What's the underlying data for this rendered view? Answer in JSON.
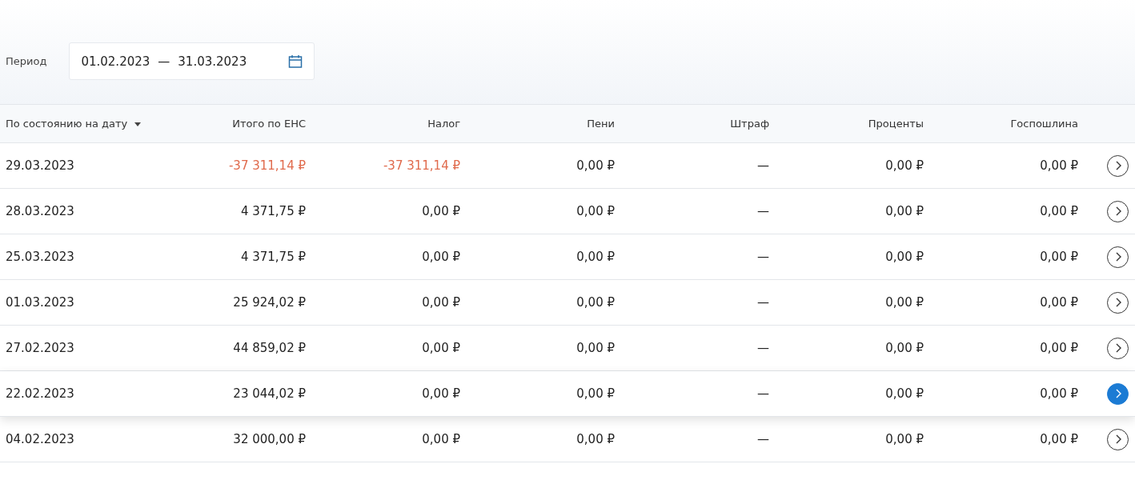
{
  "period": {
    "label": "Период",
    "from": "01.02.2023",
    "separator": "—",
    "to": "31.03.2023"
  },
  "table": {
    "columns": [
      "По состоянию на дату",
      "Итого по ЕНС",
      "Налог",
      "Пени",
      "Штраф",
      "Проценты",
      "Госпошлина"
    ],
    "rows": [
      {
        "selected": false,
        "cells": [
          {
            "text": "29.03.2023",
            "negative": false
          },
          {
            "text": "-37 311,14 ₽",
            "negative": true
          },
          {
            "text": "-37 311,14 ₽",
            "negative": true
          },
          {
            "text": "0,00 ₽",
            "negative": false
          },
          {
            "text": "—",
            "negative": false
          },
          {
            "text": "0,00 ₽",
            "negative": false
          },
          {
            "text": "0,00 ₽",
            "negative": false
          }
        ]
      },
      {
        "selected": false,
        "cells": [
          {
            "text": "28.03.2023",
            "negative": false
          },
          {
            "text": "4 371,75 ₽",
            "negative": false
          },
          {
            "text": "0,00 ₽",
            "negative": false
          },
          {
            "text": "0,00 ₽",
            "negative": false
          },
          {
            "text": "—",
            "negative": false
          },
          {
            "text": "0,00 ₽",
            "negative": false
          },
          {
            "text": "0,00 ₽",
            "negative": false
          }
        ]
      },
      {
        "selected": false,
        "cells": [
          {
            "text": "25.03.2023",
            "negative": false
          },
          {
            "text": "4 371,75 ₽",
            "negative": false
          },
          {
            "text": "0,00 ₽",
            "negative": false
          },
          {
            "text": "0,00 ₽",
            "negative": false
          },
          {
            "text": "—",
            "negative": false
          },
          {
            "text": "0,00 ₽",
            "negative": false
          },
          {
            "text": "0,00 ₽",
            "negative": false
          }
        ]
      },
      {
        "selected": false,
        "cells": [
          {
            "text": "01.03.2023",
            "negative": false
          },
          {
            "text": "25 924,02 ₽",
            "negative": false
          },
          {
            "text": "0,00 ₽",
            "negative": false
          },
          {
            "text": "0,00 ₽",
            "negative": false
          },
          {
            "text": "—",
            "negative": false
          },
          {
            "text": "0,00 ₽",
            "negative": false
          },
          {
            "text": "0,00 ₽",
            "negative": false
          }
        ]
      },
      {
        "selected": false,
        "cells": [
          {
            "text": "27.02.2023",
            "negative": false
          },
          {
            "text": "44 859,02 ₽",
            "negative": false
          },
          {
            "text": "0,00 ₽",
            "negative": false
          },
          {
            "text": "0,00 ₽",
            "negative": false
          },
          {
            "text": "—",
            "negative": false
          },
          {
            "text": "0,00 ₽",
            "negative": false
          },
          {
            "text": "0,00 ₽",
            "negative": false
          }
        ]
      },
      {
        "selected": true,
        "cells": [
          {
            "text": "22.02.2023",
            "negative": false
          },
          {
            "text": "23 044,02 ₽",
            "negative": false
          },
          {
            "text": "0,00 ₽",
            "negative": false
          },
          {
            "text": "0,00 ₽",
            "negative": false
          },
          {
            "text": "—",
            "negative": false
          },
          {
            "text": "0,00 ₽",
            "negative": false
          },
          {
            "text": "0,00 ₽",
            "negative": false
          }
        ]
      },
      {
        "selected": false,
        "cells": [
          {
            "text": "04.02.2023",
            "negative": false
          },
          {
            "text": "32 000,00 ₽",
            "negative": false
          },
          {
            "text": "0,00 ₽",
            "negative": false
          },
          {
            "text": "0,00 ₽",
            "negative": false
          },
          {
            "text": "—",
            "negative": false
          },
          {
            "text": "0,00 ₽",
            "negative": false
          },
          {
            "text": "0,00 ₽",
            "negative": false
          }
        ]
      }
    ]
  }
}
